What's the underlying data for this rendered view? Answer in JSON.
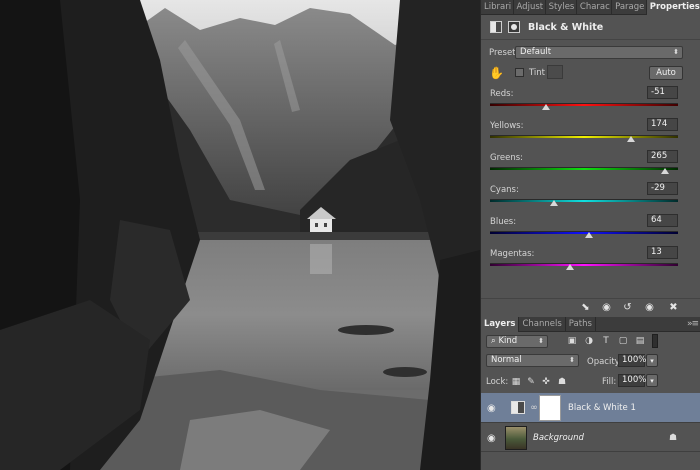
{
  "panel_tabs": [
    {
      "label": "Librari",
      "active": false
    },
    {
      "label": "Adjust",
      "active": false
    },
    {
      "label": "Styles",
      "active": false
    },
    {
      "label": "Charac",
      "active": false
    },
    {
      "label": "Parage",
      "active": false
    },
    {
      "label": "Properties",
      "active": true
    }
  ],
  "properties": {
    "title": "Black & White",
    "preset_label": "Preset:",
    "preset_value": "Default",
    "tint_label": "Tint",
    "auto_button": "Auto",
    "sliders": [
      {
        "label": "Reds:",
        "value": "-51",
        "min": -200,
        "max": 300,
        "gradient": [
          "#350000",
          "#ff1010",
          "#400000"
        ]
      },
      {
        "label": "Yellows:",
        "value": "174",
        "min": -200,
        "max": 300,
        "gradient": [
          "#303000",
          "#f0f000",
          "#303000"
        ]
      },
      {
        "label": "Greens:",
        "value": "265",
        "min": -200,
        "max": 300,
        "gradient": [
          "#002800",
          "#10e010",
          "#002800"
        ]
      },
      {
        "label": "Cyans:",
        "value": "-29",
        "min": -200,
        "max": 300,
        "gradient": [
          "#002a2a",
          "#10e0e0",
          "#002a2a"
        ]
      },
      {
        "label": "Blues:",
        "value": "64",
        "min": -200,
        "max": 300,
        "gradient": [
          "#000030",
          "#1010ff",
          "#000030"
        ]
      },
      {
        "label": "Magentas:",
        "value": "13",
        "min": -200,
        "max": 300,
        "gradient": [
          "#300030",
          "#ff10ff",
          "#300030"
        ]
      }
    ]
  },
  "layers_tabs": [
    {
      "label": "Layers",
      "active": true
    },
    {
      "label": "Channels",
      "active": false
    },
    {
      "label": "Paths",
      "active": false
    }
  ],
  "layers": {
    "filter_kind": "Kind",
    "blend_mode": "Normal",
    "opacity_label": "Opacity:",
    "opacity_value": "100%",
    "lock_label": "Lock:",
    "fill_label": "Fill:",
    "fill_value": "100%",
    "items": [
      {
        "name": "Black & White 1",
        "selected": true
      },
      {
        "name": "Background",
        "selected": false
      }
    ]
  },
  "colors": {
    "panel_bg": "#535353",
    "selected_layer": "#6f7f98",
    "tab_bar": "#3c3c3c"
  }
}
